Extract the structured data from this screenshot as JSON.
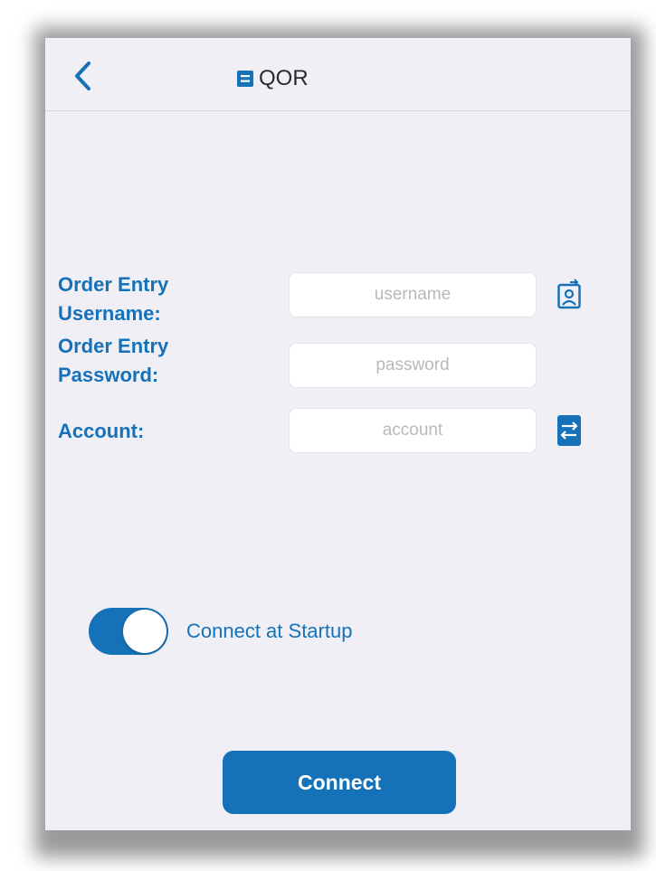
{
  "header": {
    "title": "QOR",
    "back_icon": "chevron-left-icon",
    "title_icon": "document-icon"
  },
  "form": {
    "username": {
      "label_line1": "Order Entry",
      "label_line2": "Username:",
      "value": "",
      "placeholder": "username",
      "side_icon": "contact-card-icon"
    },
    "password": {
      "label_line1": "Order Entry",
      "label_line2": "Password:",
      "value": "",
      "placeholder": "password"
    },
    "account": {
      "label": "Account:",
      "value": "",
      "placeholder": "account",
      "side_icon": "swap-arrows-icon"
    }
  },
  "startup_toggle": {
    "label": "Connect at Startup",
    "on": true
  },
  "connect_button": {
    "label": "Connect"
  },
  "colors": {
    "accent": "#1572b8",
    "background": "#f0eff5",
    "field_background": "#ffffff",
    "placeholder": "#b9b9bd"
  }
}
